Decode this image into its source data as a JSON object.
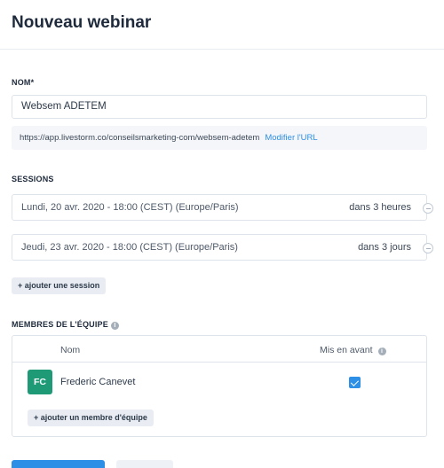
{
  "page": {
    "title": "Nouveau webinar"
  },
  "name_section": {
    "label": "NOM*",
    "value": "Websem ADETEM",
    "url": "https://app.livestorm.co/conseilsmarketing-com/websem-adetem",
    "edit_url_link": "Modifier l'URL"
  },
  "sessions_section": {
    "label": "SESSIONS",
    "items": [
      {
        "date": "Lundi, 20 avr. 2020 - 18:00 (CEST) (Europe/Paris)",
        "relative": "dans 3 heures"
      },
      {
        "date": "Jeudi, 23 avr. 2020 - 18:00 (CEST) (Europe/Paris)",
        "relative": "dans 3 jours"
      }
    ],
    "add_button": "+ ajouter une session"
  },
  "team_section": {
    "label": "MEMBRES DE L'ÉQUIPE",
    "columns": {
      "name": "Nom",
      "featured": "Mis en avant"
    },
    "members": [
      {
        "initials": "FC",
        "name": "Frederic Canevet",
        "featured": true
      }
    ],
    "add_button": "+ ajouter un membre d'équipe"
  },
  "colors": {
    "accent": "#2e8fe6",
    "avatar": "#1e9b76"
  },
  "icons": {
    "info": "info-icon",
    "remove": "remove-circle-icon",
    "check": "checkmark-icon"
  }
}
